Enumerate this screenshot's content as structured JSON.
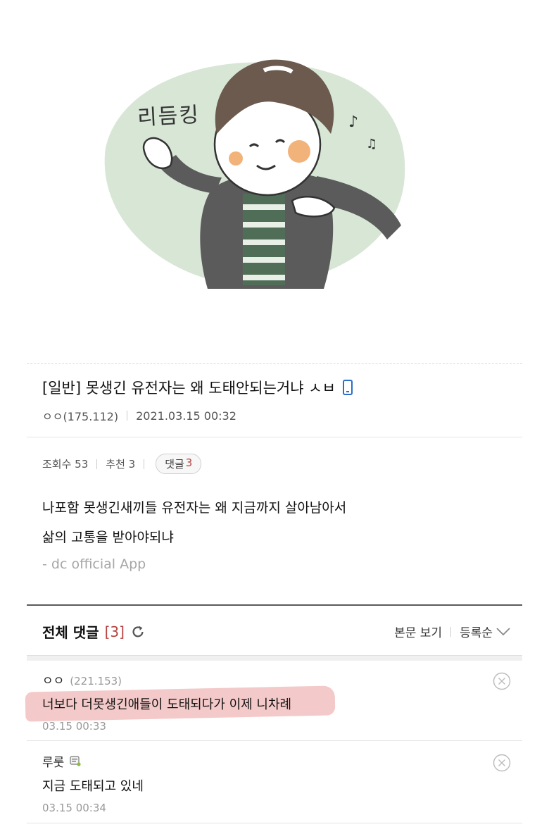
{
  "sticker": {
    "caption": "리듬킹",
    "icon": "dancing-boy-sticker"
  },
  "post": {
    "title": "[일반] 못생긴 유전자는 왜 도태안되는거냐 ㅅㅂ",
    "author": "ㅇㅇ(175.112)",
    "datetime": "2021.03.15 00:32",
    "views_label": "조회수 53",
    "recommend_label": "추천 3",
    "reply_label": "댓글",
    "reply_count": "3",
    "body_lines": [
      "나포함 못생긴새끼들 유전자는 왜 지금까지 살아남아서",
      "삶의 고통을 받아야되냐"
    ],
    "app_signature": "- dc official App"
  },
  "comments_header": {
    "title": "전체 댓글",
    "count": "[3]",
    "view_post": "본문 보기",
    "sort": "등록순"
  },
  "comments": [
    {
      "author": "ㅇㅇ",
      "ip": "(221.153)",
      "text": "너보다 더못생긴애들이 도태되다가 이제 니차례",
      "date": "03.15 00:33"
    },
    {
      "author": "루룻",
      "ip": "",
      "text": "지금 도태되고 있네",
      "date": "03.15 00:34"
    }
  ],
  "colors": {
    "accent_red": "#b6423f",
    "mobile_blue": "#2b6fc9",
    "highlight": "#f2c0c0"
  }
}
